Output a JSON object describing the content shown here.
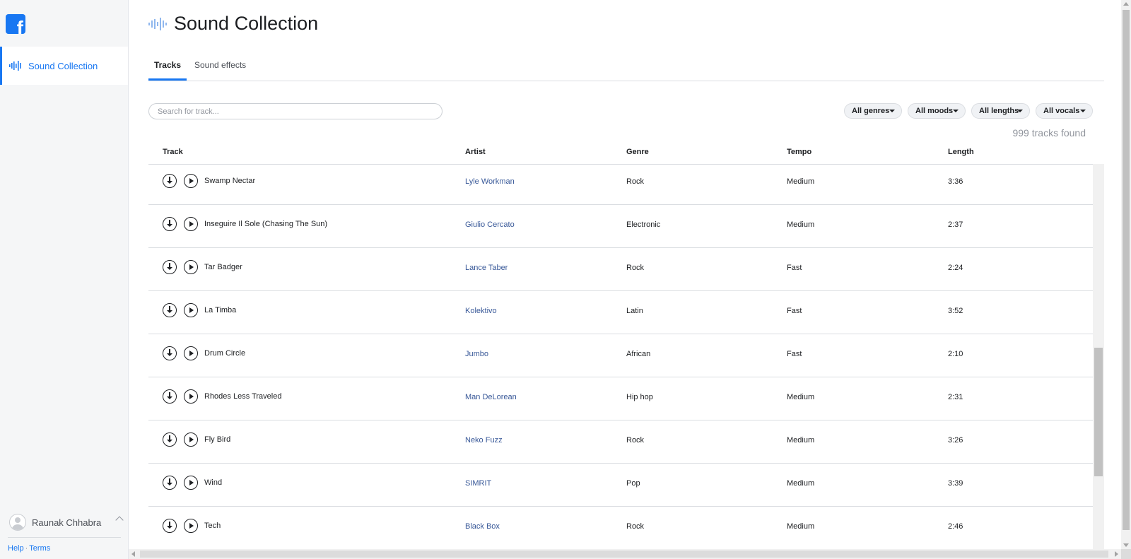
{
  "app": {
    "logo_icon": "facebook-logo-icon",
    "accent_color": "#1877f2",
    "link_color": "#385898"
  },
  "sidebar": {
    "items": [
      {
        "label": "Sound Collection",
        "icon": "sound-wave-icon",
        "active": true
      }
    ],
    "user": {
      "name": "Raunak Chhabra",
      "avatar_icon": "user-avatar-icon"
    },
    "footer": {
      "help_label": "Help",
      "terms_label": "Terms"
    }
  },
  "header": {
    "title": "Sound Collection",
    "icon": "sound-wave-icon"
  },
  "tabs": [
    {
      "label": "Tracks",
      "active": true
    },
    {
      "label": "Sound effects",
      "active": false
    }
  ],
  "search": {
    "placeholder": "Search for track...",
    "value": ""
  },
  "filters": [
    {
      "label": "All genres"
    },
    {
      "label": "All moods"
    },
    {
      "label": "All lengths"
    },
    {
      "label": "All vocals"
    }
  ],
  "results": {
    "count_label": "999 tracks found"
  },
  "table": {
    "columns": [
      "Track",
      "Artist",
      "Genre",
      "Tempo",
      "Length"
    ],
    "rows": [
      {
        "track": "Swamp Nectar",
        "artist": "Lyle Workman",
        "genre": "Rock",
        "tempo": "Medium",
        "length": "3:36"
      },
      {
        "track": "Inseguire Il Sole (Chasing The Sun)",
        "artist": "Giulio Cercato",
        "genre": "Electronic",
        "tempo": "Medium",
        "length": "2:37"
      },
      {
        "track": "Tar Badger",
        "artist": "Lance Taber",
        "genre": "Rock",
        "tempo": "Fast",
        "length": "2:24"
      },
      {
        "track": "La Timba",
        "artist": "Kolektivo",
        "genre": "Latin",
        "tempo": "Fast",
        "length": "3:52"
      },
      {
        "track": "Drum Circle",
        "artist": "Jumbo",
        "genre": "African",
        "tempo": "Fast",
        "length": "2:10"
      },
      {
        "track": "Rhodes Less Traveled",
        "artist": "Man DeLorean",
        "genre": "Hip hop",
        "tempo": "Medium",
        "length": "2:31"
      },
      {
        "track": "Fly Bird",
        "artist": "Neko Fuzz",
        "genre": "Rock",
        "tempo": "Medium",
        "length": "3:26"
      },
      {
        "track": "Wind",
        "artist": "SIMRIT",
        "genre": "Pop",
        "tempo": "Medium",
        "length": "3:39"
      },
      {
        "track": "Tech",
        "artist": "Black Box",
        "genre": "Rock",
        "tempo": "Medium",
        "length": "2:46"
      }
    ]
  }
}
